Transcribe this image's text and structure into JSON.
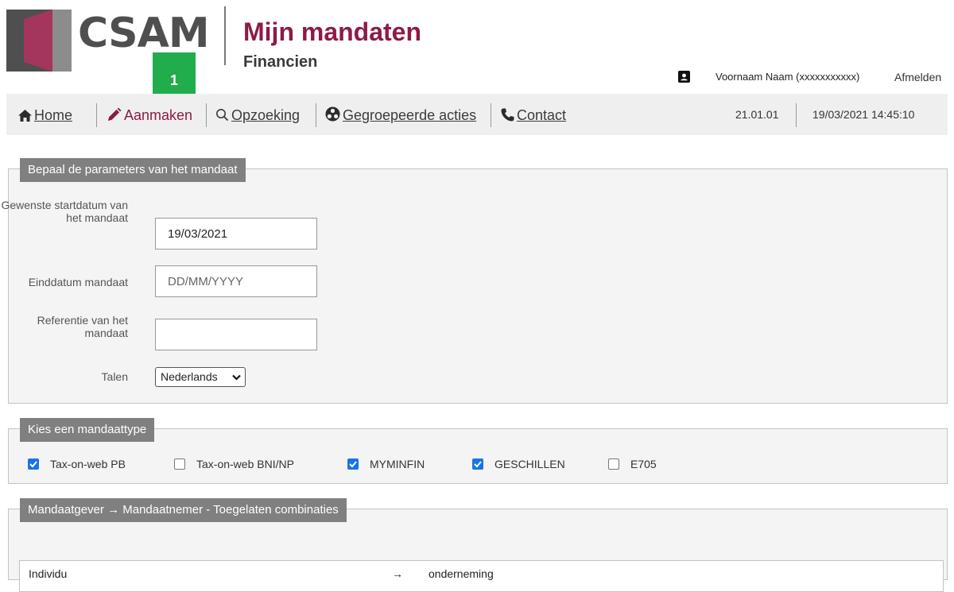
{
  "header": {
    "logo_text": "CSAM",
    "app_title": "Mijn mandaten",
    "app_subtitle": "Financien",
    "user_name": "Voornaam Naam (xxxxxxxxxxx)",
    "logout_label": "Afmelden"
  },
  "annotation_badge": "1",
  "nav": {
    "items": [
      {
        "label": "Home",
        "icon": "home-icon"
      },
      {
        "label": "Aanmaken",
        "icon": "pencil-icon",
        "active": true
      },
      {
        "label": "Opzoeking",
        "icon": "search-icon"
      },
      {
        "label": "Gegroepeerde acties",
        "icon": "group-icon"
      },
      {
        "label": "Contact",
        "icon": "phone-icon"
      }
    ],
    "version": "21.01.01",
    "datetime": "19/03/2021 14:45:10"
  },
  "params": {
    "legend": "Bepaal de parameters van het mandaat",
    "startdate_label": "Gewenste startdatum van het mandaat",
    "startdate_value": "19/03/2021",
    "enddate_label": "Einddatum mandaat",
    "enddate_placeholder": "DD/MM/YYYY",
    "reference_label": "Referentie van het mandaat",
    "reference_value": "",
    "language_label": "Talen",
    "language_selected": "Nederlands"
  },
  "types": {
    "legend": "Kies een mandaattype",
    "options": [
      {
        "label": "Tax-on-web PB",
        "checked": true
      },
      {
        "label": "Tax-on-web BNI/NP",
        "checked": false
      },
      {
        "label": "MYMINFIN",
        "checked": true
      },
      {
        "label": "GESCHILLEN",
        "checked": true
      },
      {
        "label": "E705",
        "checked": false
      }
    ]
  },
  "combinations": {
    "legend": "Mandaatgever → Mandaatnemer - Toegelaten combinaties",
    "rows": [
      {
        "from": "Individu",
        "arrow": "→",
        "to": "onderneming"
      }
    ]
  },
  "colors": {
    "brand": "#8c1b47",
    "legend_bg": "#808080",
    "badge": "#22ad4d",
    "checkbox": "#1a73e8"
  }
}
